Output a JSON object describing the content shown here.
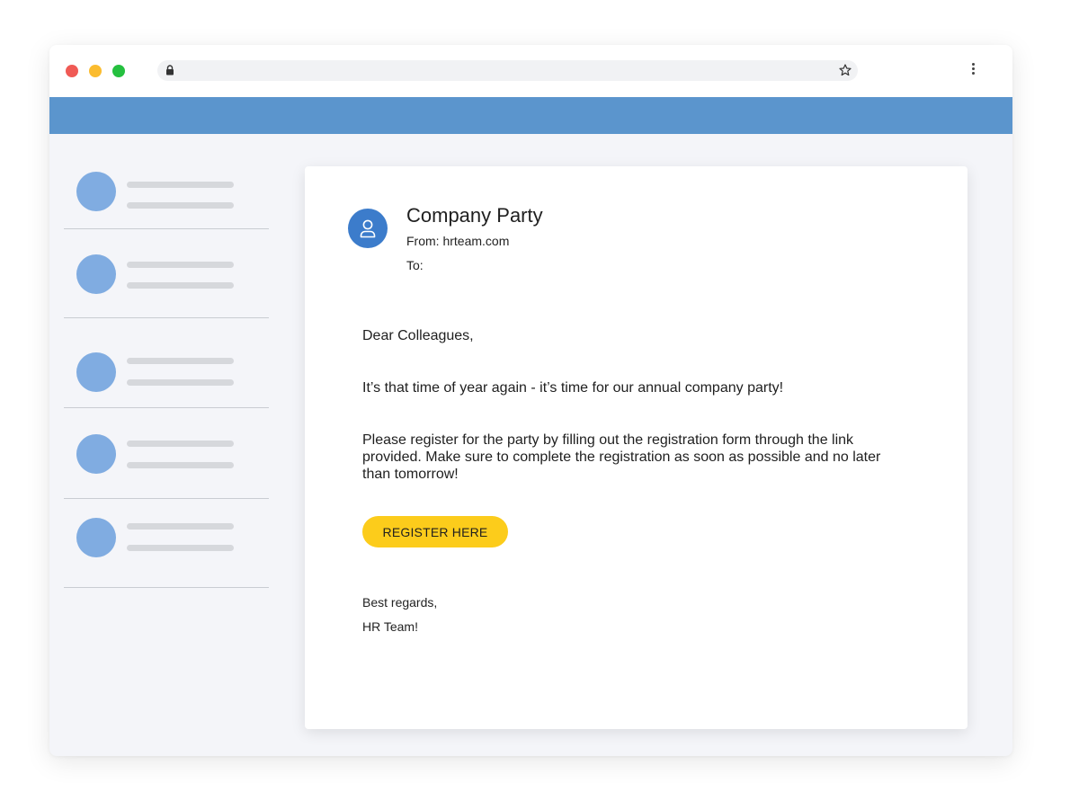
{
  "browser": {
    "url": "",
    "icons": {
      "lock": "lock-icon",
      "bookmark": "star-icon",
      "menu": "more-vertical-icon"
    },
    "window_controls": [
      "close",
      "minimize",
      "maximize"
    ]
  },
  "colors": {
    "app_bar": "#5b95cd",
    "accent": "#3c7ccb",
    "button": "#fccc1b",
    "placeholder_avatar": "#80ace1"
  },
  "sidebar": {
    "item_count": 5
  },
  "email": {
    "subject": "Company Party",
    "from": "From: hrteam.com",
    "to": "To:",
    "greeting": "Dear Colleagues,",
    "intro": "It’s that time of year again - it’s time for our annual company party!",
    "instructions": "Please register for the party by filling out the registration form through the link provided. Make sure to complete the registration as soon as possible and no later than tomorrow!",
    "button_label": "REGISTER HERE",
    "signoff": "Best regards,",
    "signature": "HR Team!"
  }
}
